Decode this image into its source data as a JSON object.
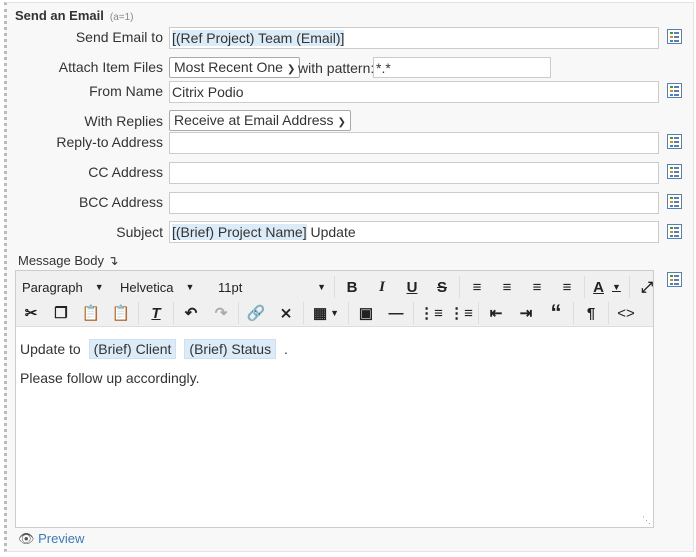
{
  "title": "Send an Email",
  "title_note": "(a=1)",
  "fields": {
    "send_to": {
      "label": "Send Email to",
      "token": "[(Ref Project) Team (Email)]"
    },
    "attach": {
      "label": "Attach Item Files",
      "selected": "Most Recent One",
      "pattern_label": "with pattern:",
      "pattern": "*.*"
    },
    "from_name": {
      "label": "From Name",
      "value": "Citrix Podio"
    },
    "with_replies": {
      "label": "With Replies",
      "selected": "Receive at Email Address"
    },
    "reply_to": {
      "label": "Reply-to Address",
      "value": ""
    },
    "cc": {
      "label": "CC Address",
      "value": ""
    },
    "bcc": {
      "label": "BCC Address",
      "value": ""
    },
    "subject": {
      "label": "Subject",
      "token": "[(Brief) Project Name]",
      "text": " Update"
    }
  },
  "message_body": {
    "label": "Message Body",
    "arrow": "↴",
    "toolbar": {
      "format": "Paragraph",
      "font": "Helvetica",
      "size": "11pt"
    },
    "line1_prefix": "Update to",
    "chip1": "(Brief) Client",
    "chip2": "(Brief) Status",
    "line1_suffix": ".",
    "line2": "Please follow up accordingly."
  },
  "preview_label": "Preview",
  "icons": {
    "field_picker": "field-list-icon"
  }
}
